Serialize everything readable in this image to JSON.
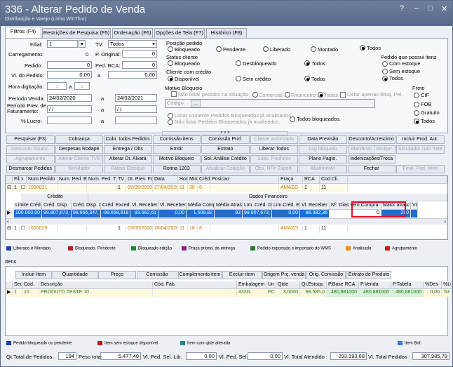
{
  "window": {
    "title": "336 - Alterar Pedido de Venda",
    "subtitle": "Distribuição e Varejo (Linha WinThor)",
    "help_btn": "?",
    "min_btn": "–",
    "max_btn": "□",
    "close_btn": "✕"
  },
  "tabs": [
    "Filtros (F4)",
    "Restrições de Pesquisa (F5)",
    "Ordenação (F6)",
    "Opções de Tela (F7)",
    "Histórico (F8)"
  ],
  "filters": {
    "filial_label": "Filial:",
    "filial_value": "1",
    "tv_label": "TV:",
    "tv_value": "Todos",
    "carregamento_label": "Carregamento:",
    "carregamento_value": "0",
    "poriginal_label": "P. Original:",
    "poriginal_value": "0",
    "pedido_label": "Pedido:",
    "pedido_value": "0",
    "pedrca_label": "Ped. RCA:",
    "pedrca_value": "0",
    "vlpedido_label": "Vl. do Pedido:",
    "vlpedido_from": "0,00",
    "a_label": "a",
    "vlpedido_to": "0,00",
    "hora_label": "Hora digitação:",
    "hora_from": ":",
    "hora_to": ":",
    "periodo_label": "Período Venda:",
    "periodo_from": "24/02/2020",
    "periodo_to": "24/02/2021",
    "periodo_fat_label": "Período Prev. de Faturamento:",
    "periodo_fat_from": "/ /",
    "periodo_fat_to": "/ /",
    "lucro_label": "% Lucro:",
    "lucro_from": "",
    "lucro_to": ""
  },
  "posicao": {
    "label": "Posição pedido",
    "options": [
      "Bloqueado",
      "Pendente",
      "Liberado",
      "Montado",
      "Todos"
    ]
  },
  "status_cliente": {
    "label": "Status cliente",
    "options": [
      "Bloqueado",
      "Desbloqueado",
      "Todos"
    ]
  },
  "credito": {
    "label": "Cliente com crédito",
    "options": [
      "Disponível",
      "Sem crédito",
      "Todos"
    ]
  },
  "motivo": {
    "label": "Motivo Bloqueio",
    "nao_listar": "Não listar pedidos na situação:",
    "comercial": "Comercial",
    "financeiro": "Financeiro",
    "todos": "Todos",
    "listar_apenas": "Listar apenas Bloq. Pel.",
    "codigo_label": "Código",
    "codigo_btn": "...",
    "opt1": "Listar somente Pedidos Bloqueados já analisados.",
    "opt2": "Não listar Pedidos Bloqueados já analisados.",
    "opt3": "Todos bloqueados."
  },
  "estoque": {
    "label": "Pedido que possui itens",
    "options": [
      "Com estoque",
      "Sem estoque",
      "Todos"
    ]
  },
  "frete": {
    "label": "Frete",
    "options": [
      "CIF",
      "FOB",
      "Gratuito",
      "Todos"
    ]
  },
  "buttons": {
    "row1": [
      "Pesquisar (F3)",
      "Cobrança",
      "Cobr. todos Pedidos",
      "Comissão itens",
      "Comissão Prof.",
      "Cliente autorizado",
      "Data Previsão",
      "Desconto/Acrescimo",
      "Incluir Prod. Aut."
    ],
    "row2": [
      "Desconto Financ.",
      "Despesas Rodapé",
      "Entrega / Obs",
      "Emitir",
      "Extrato",
      "Liberar Todos",
      "Log bloqueio",
      "Manifesto / Brokjer",
      "Simulador com frete"
    ],
    "row3": [
      "Agrupamento",
      "Alterar Cliente TV8",
      "Alterar Dt. Alvará",
      "Motivo Bloqueio",
      "Sol. Análise Crédito",
      "Subs. Produtos",
      "Plano Pagto.",
      "Indenizações/Troca",
      ""
    ],
    "row4": [
      "Desmarcar Pedidos",
      "Simulador",
      "Ratear Estoque",
      "Rotina 1203",
      "Atualizar Cotação",
      "Obs. NFe Export.",
      "Abatimento",
      "Fechar",
      "Final. Ped. Web"
    ]
  },
  "orders": {
    "headers": [
      "Filial",
      "x",
      "Num.Pedido",
      "Num. Ped. B",
      "Num. Ped. T",
      "TV",
      "Dt. Prev. Fa",
      "Data",
      "Hor",
      "Min",
      "Créd",
      "Posicao",
      "Praça",
      "RCA",
      "Cod.Cli."
    ],
    "rows": [
      [
        "1",
        "",
        "1000021",
        "",
        "",
        "1",
        "02/05/2020",
        "27/04/2020",
        "11",
        "38",
        "8",
        "",
        "AMAZO",
        "1",
        "11"
      ],
      [
        "1",
        "",
        "1000029",
        "",
        "",
        "1",
        "03/05/2020",
        "28/04/2020",
        "11",
        "18",
        "8",
        "",
        "AMAZO",
        "1",
        "11"
      ]
    ],
    "group_credito": "Crédito",
    "group_financeiro": "Dados Financeiro",
    "detail_headers": [
      "Limite Créd.",
      "Créd. Disp.",
      "Créd. Disp. I",
      "Créd. Exced",
      "Vl. Receber",
      "Vl. Receber",
      "Média Comp",
      "Média Atrasc",
      "Lim. Créd. D",
      "Lim.Créd. E",
      "Vl. Receber",
      "Nº. Dias sem Compra",
      "Maior atrasc",
      "VL"
    ],
    "detail_row": [
      "100.000,00",
      "99.807,673,",
      "99.666,347,",
      "-99.658,818",
      "93.662,61",
      "0,00",
      "1.509,82",
      "93",
      "99.807,673,",
      "0,00",
      "88.382,36",
      "0",
      "280",
      ""
    ]
  },
  "legend1": [
    {
      "text": "Liberado e Montado",
      "color": "#1f3fb0"
    },
    {
      "text": "Bloqueado. Pendente",
      "color": "#c01818"
    },
    {
      "text": "Bloqueado edição",
      "color": "#1a8a2a"
    },
    {
      "text": "Praça priorid. de entrega",
      "color": "#8a1f8a"
    },
    {
      "text": "Pedido exportado e importado do WMS",
      "color": "#2a7a2a"
    },
    {
      "text": "Analisado",
      "color": "#f08a00"
    },
    {
      "text": "Agrupamento",
      "color": "#d01818"
    }
  ],
  "items": {
    "tab_label": "Itens",
    "buttons": [
      "Incluir Item",
      "Quantidade",
      "Preço",
      "Comissão",
      "Complemento item",
      "Excluir item",
      "Origem Prç. venda",
      "Orig. Comissão",
      "Extrato do Produto"
    ],
    "headers": [
      "Sec",
      "Cód.",
      "Descrição",
      "Cód. Fáb.",
      "Embalagem",
      "Un",
      "Qtde",
      "Qt.Estoqu",
      "P.Base RCA",
      "P.Venda",
      "P.Tabela",
      "%Des",
      "%Lu"
    ],
    "row": [
      "1",
      "10",
      "PRODUTO TESTE 10",
      "",
      "432G.",
      "PC",
      "3,0000",
      "98.535,0",
      "480,881000",
      "480,881000",
      "480,881000",
      "0,00",
      "53"
    ]
  },
  "legend2": [
    {
      "text": "Pedido bloqueado ou pendente",
      "color": "#1f3fb0"
    },
    {
      "text": "Item sem estoque disponível",
      "color": "#c01818"
    },
    {
      "text": "Item com qtde alterada",
      "color": "#1a8a8a"
    },
    {
      "text": "Item Bnf.",
      "color": "#3a7ad8"
    }
  ],
  "statusbar": {
    "qt_label": "Qt.Total de Pedidos",
    "qt_value": "194",
    "peso_label": "Peso total",
    "peso_value": "5.477,40",
    "vlsel_label": "Vl. Ped. Sel. Lib.",
    "vlsel_value": "0,00",
    "vlpedsel_label": "Vl. Ped. Sel.",
    "vlpedsel_value": "0,00",
    "vlatend_label": "Vl. Total Atendido :",
    "vlatend_value": "293.193,68",
    "vltotal_label": "Vl. Total Pedidos :",
    "vltotal_value": "307.985,78"
  }
}
